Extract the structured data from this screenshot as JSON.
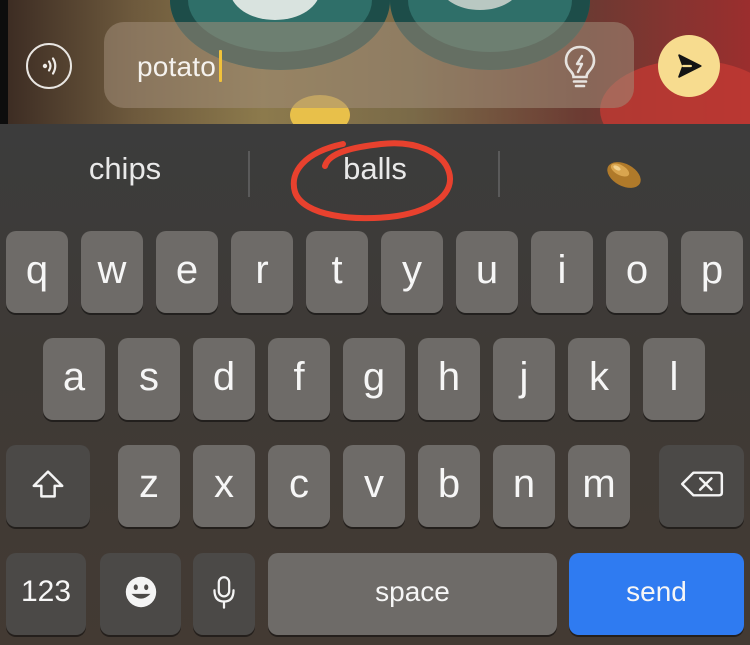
{
  "input": {
    "value": "potato"
  },
  "suggestions": [
    "chips",
    "balls"
  ],
  "suggestion_emoji": "bean-emoji",
  "annotation": {
    "shape": "hand-drawn-circle",
    "color": "#e8412e",
    "target": "balls"
  },
  "keyboard": {
    "row1": [
      "q",
      "w",
      "e",
      "r",
      "t",
      "y",
      "u",
      "i",
      "o",
      "p"
    ],
    "row2": [
      "a",
      "s",
      "d",
      "f",
      "g",
      "h",
      "j",
      "k",
      "l"
    ],
    "row3": [
      "z",
      "x",
      "c",
      "v",
      "b",
      "n",
      "m"
    ],
    "numbers_label": "123",
    "space_label": "space",
    "send_label": "send"
  },
  "colors": {
    "send_key": "#2f7bf1",
    "caret": "#f1c23a",
    "send_button": "#f7dc8f"
  },
  "icons": [
    "audio-waves-icon",
    "lightbulb-icon",
    "send-arrow-icon",
    "shift-icon",
    "backspace-icon",
    "emoji-icon",
    "microphone-icon"
  ]
}
